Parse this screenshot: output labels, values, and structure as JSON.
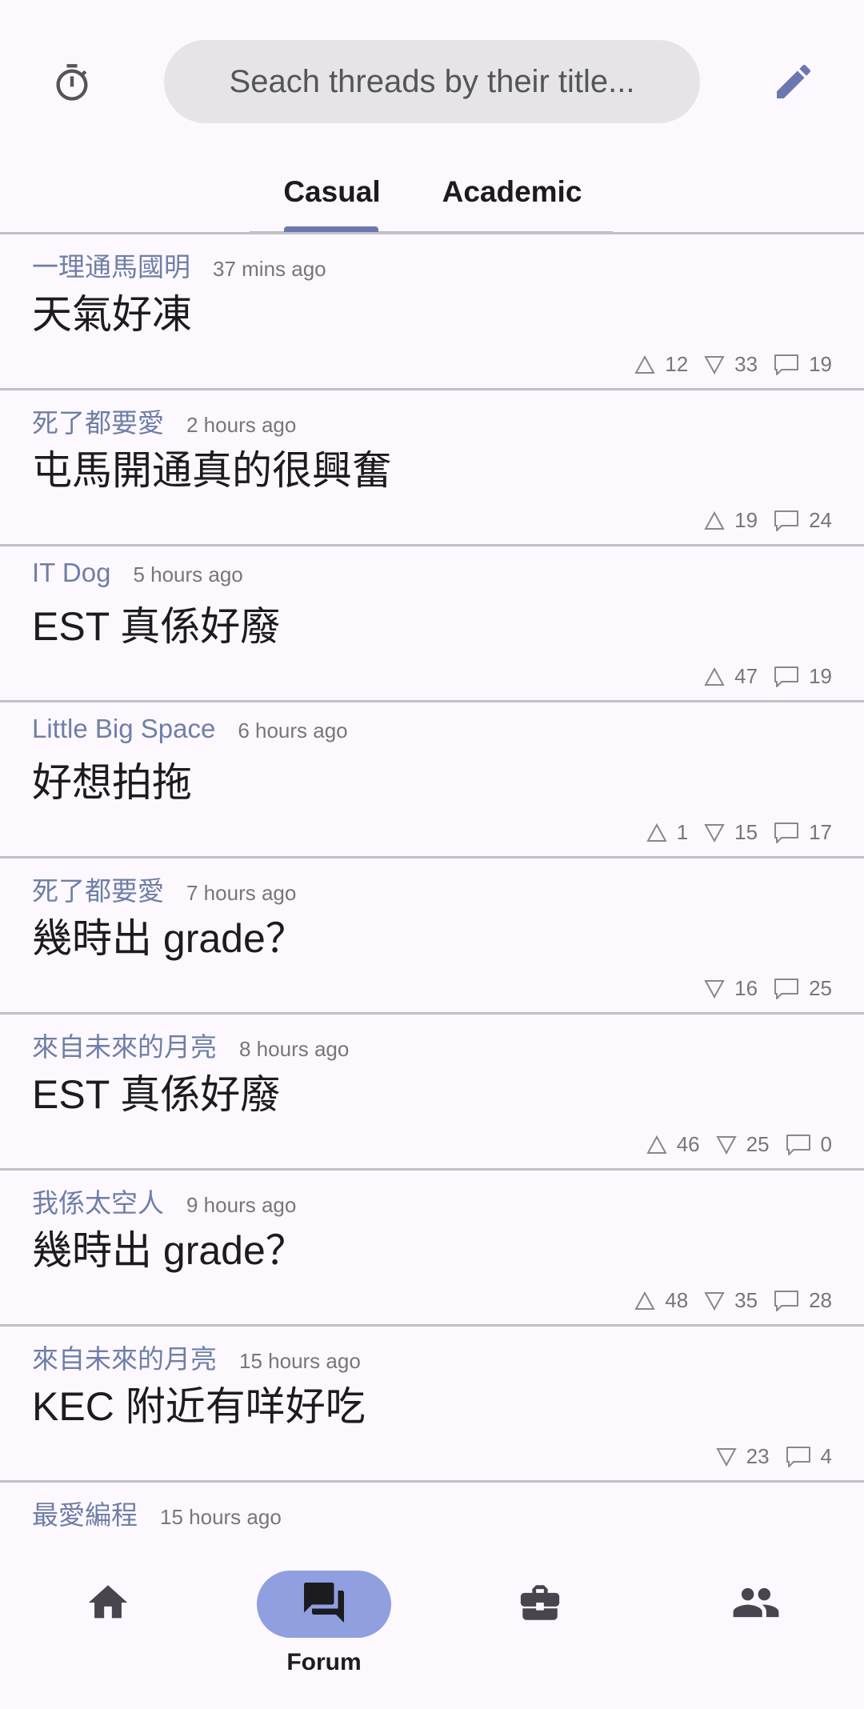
{
  "search": {
    "placeholder": "Seach threads by their title..."
  },
  "tabs": [
    {
      "label": "Casual",
      "active": true
    },
    {
      "label": "Academic",
      "active": false
    }
  ],
  "threads": [
    {
      "author": "一理通馬國明",
      "time": "37 mins ago",
      "title": "天氣好凍",
      "upvotes": "12",
      "downvotes": "33",
      "comments": "19"
    },
    {
      "author": "死了都要愛",
      "time": "2 hours ago",
      "title": "屯馬開通真的很興奮",
      "upvotes": "19",
      "downvotes": null,
      "comments": "24"
    },
    {
      "author": "IT Dog",
      "time": "5 hours ago",
      "title": "EST 真係好廢",
      "upvotes": "47",
      "downvotes": null,
      "comments": "19"
    },
    {
      "author": "Little Big Space",
      "time": "6 hours ago",
      "title": "好想拍拖",
      "upvotes": "1",
      "downvotes": "15",
      "comments": "17"
    },
    {
      "author": "死了都要愛",
      "time": "7 hours ago",
      "title": "幾時出 grade？",
      "upvotes": null,
      "downvotes": "16",
      "comments": "25"
    },
    {
      "author": "來自未來的月亮",
      "time": "8 hours ago",
      "title": "EST 真係好廢",
      "upvotes": "46",
      "downvotes": "25",
      "comments": "0"
    },
    {
      "author": "我係太空人",
      "time": "9 hours ago",
      "title": "幾時出 grade？",
      "upvotes": "48",
      "downvotes": "35",
      "comments": "28"
    },
    {
      "author": "來自未來的月亮",
      "time": "15 hours ago",
      "title": "KEC 附近有咩好吃",
      "upvotes": null,
      "downvotes": "23",
      "comments": "4"
    },
    {
      "author": "最愛編程",
      "time": "15 hours ago",
      "title": "",
      "upvotes": null,
      "downvotes": null,
      "comments": null
    }
  ],
  "nav": {
    "items": [
      {
        "icon": "home-icon",
        "label": "",
        "active": false
      },
      {
        "icon": "forum-icon",
        "label": "Forum",
        "active": true
      },
      {
        "icon": "briefcase-icon",
        "label": "",
        "active": false
      },
      {
        "icon": "people-icon",
        "label": "",
        "active": false
      }
    ]
  },
  "colors": {
    "accent": "#6b78b0",
    "active_pill": "#8f9fe0",
    "author": "#6e7fa8"
  }
}
